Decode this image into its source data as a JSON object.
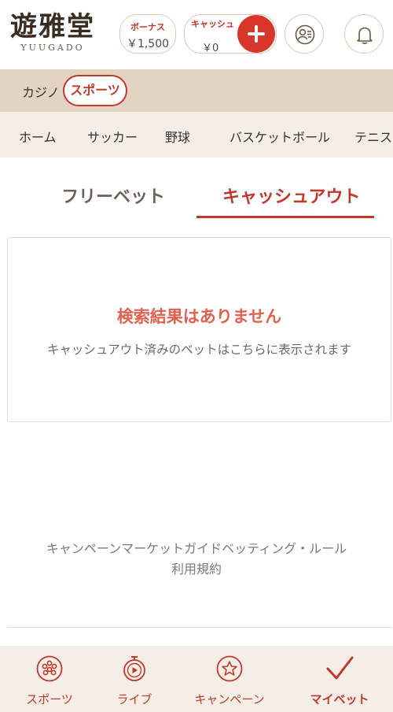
{
  "header": {
    "logo_main": "遊雅堂",
    "logo_sub": "YUUGADO",
    "bonus_label": "ボーナス",
    "bonus_value": "￥1,500",
    "cash_label": "キャッシュ",
    "cash_value": "￥0"
  },
  "mode_tabs": {
    "casino": "カジノ",
    "sports": "スポーツ"
  },
  "categories": [
    "ホーム",
    "サッカー",
    "野球",
    "バスケットボール",
    "テニス"
  ],
  "bet_tabs": {
    "free_bet": "フリーベット",
    "cash_out": "キャッシュアウト"
  },
  "empty_state": {
    "title": "検索結果はありません",
    "description": "キャッシュアウト済みのベットはこちらに表示されます"
  },
  "footer": {
    "links_line1": "キャンペーンマーケットガイドベッティング・ルール",
    "links_line2": "利用規約"
  },
  "bottom_nav": {
    "sports": "スポーツ",
    "live": "ライブ",
    "campaign": "キャンペーン",
    "mybets": "マイベット"
  },
  "colors": {
    "accent": "#c0392b",
    "accent_light": "#e2604f",
    "mode_bar_bg": "#e3d3c2",
    "nav_bg": "#f5eee6"
  },
  "icons": {
    "plus": "plus-icon",
    "profile": "profile-icon",
    "bell": "bell-icon",
    "sports": "soccer-ball-icon",
    "live": "stopwatch-play-icon",
    "campaign": "star-icon",
    "mybets": "checkmark-icon"
  }
}
